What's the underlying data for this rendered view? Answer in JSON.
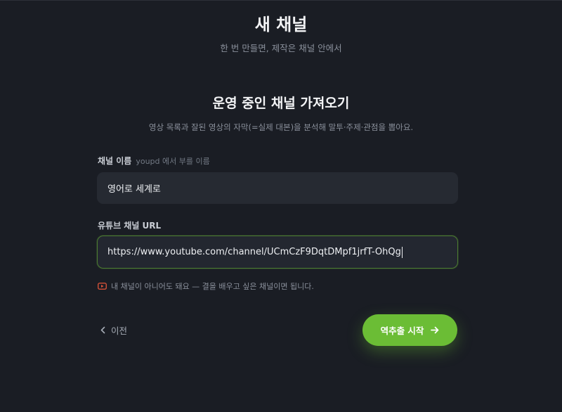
{
  "header": {
    "title": "새 채널",
    "subtitle": "한 번 만들면, 제작은 채널 안에서"
  },
  "section": {
    "title": "운영 중인 채널 가져오기",
    "description": "영상 목록과 잘된 영상의 자막(=실제 대본)을 분석해 말투·주제·관점을 뽑아요."
  },
  "form": {
    "channel_name": {
      "label": "채널 이름",
      "hint": "youpd 에서 부를 이름",
      "value": "영어로 세계로"
    },
    "youtube_url": {
      "label": "유튜브 채널 URL",
      "value": "https://www.youtube.com/channel/UCmCzF9DqtDMpf1jrfT-OhQg"
    },
    "note": "내 채널이 아니어도 돼요 — 결을 배우고 싶은 채널이면 됩니다."
  },
  "actions": {
    "back_label": "이전",
    "submit_label": "역추출 시작"
  },
  "colors": {
    "background": "#1a1d24",
    "accent": "#6bbd35",
    "input_bg": "#262a32",
    "focus_border": "#4c7a32",
    "youtube_icon": "#e2553a"
  },
  "icons": {
    "note": "youtube-icon",
    "back": "chevron-left-icon",
    "submit": "arrow-right-icon"
  }
}
